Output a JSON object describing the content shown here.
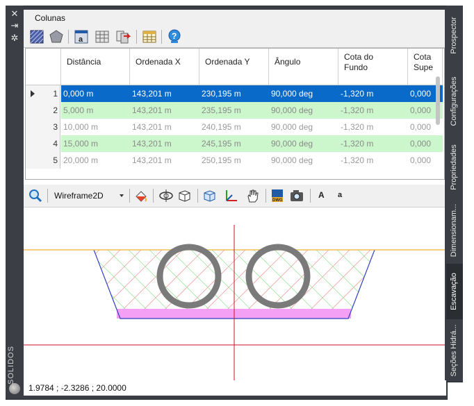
{
  "panel": {
    "side_label": "SOLIDOS",
    "status": "1.9784 ; -2.3286 ; 20.0000"
  },
  "menu": {
    "item": "Colunas"
  },
  "grid": {
    "columns": [
      "Distância",
      "Ordenada X",
      "Ordenada Y",
      "Ângulo",
      "Cota do\nFundo",
      "Cota\nSupe"
    ],
    "rows": [
      {
        "n": "1",
        "values": [
          "0,000 m",
          "143,201 m",
          "230,195 m",
          "90,000 deg",
          "-1,320 m",
          "0,000"
        ]
      },
      {
        "n": "2",
        "values": [
          "5,000 m",
          "143,201 m",
          "235,195 m",
          "90,000 deg",
          "-1,320 m",
          "0,000"
        ]
      },
      {
        "n": "3",
        "values": [
          "10,000 m",
          "143,201 m",
          "240,195 m",
          "90,000 deg",
          "-1,320 m",
          "0,000"
        ]
      },
      {
        "n": "4",
        "values": [
          "15,000 m",
          "143,201 m",
          "245,195 m",
          "90,000 deg",
          "-1,320 m",
          "0,000"
        ]
      },
      {
        "n": "5",
        "values": [
          "20,000 m",
          "143,201 m",
          "250,195 m",
          "90,000 deg",
          "-1,320 m",
          "0,000"
        ]
      }
    ]
  },
  "view_toolbar": {
    "visual_style": "Wireframe2D",
    "text_large": "A",
    "text_small": "a",
    "dwg_label": "DWG"
  },
  "tabs": [
    "Prospector",
    "Configurações",
    "Propriedades",
    "Dimensionam...",
    "Escavação",
    "Seções Hidrá..."
  ],
  "colors": {
    "selected_row": "#0a6ac9",
    "alt_row": "#ccf7cc",
    "ground_line": "#f0b030",
    "axis_line": "#c8102e",
    "bedding": "#f4a0f4",
    "pipe": "#7a7a7a"
  }
}
